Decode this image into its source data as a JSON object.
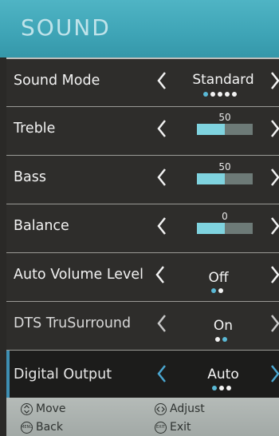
{
  "header": {
    "title": "SOUND"
  },
  "rows": [
    {
      "label": "Sound Mode",
      "value": "Standard",
      "dots": 5,
      "active_dot": 0
    },
    {
      "label": "Treble",
      "value": "50",
      "level": 0.5
    },
    {
      "label": "Bass",
      "value": "50",
      "level": 0.5
    },
    {
      "label": "Balance",
      "value": "0",
      "level": 0.5
    },
    {
      "label": "Auto Volume Level",
      "value": "Off",
      "dots": 2,
      "active_dot": 0
    },
    {
      "label": "DTS TruSurround",
      "value": "On",
      "dots": 2,
      "active_dot": 1
    },
    {
      "label": "Digital Output",
      "value": "Auto",
      "dots": 3,
      "active_dot": 0
    }
  ],
  "footer": {
    "move": "Move",
    "adjust": "Adjust",
    "back": "Back",
    "exit": "Exit",
    "back_key": "MENU",
    "exit_key": "EXIT"
  },
  "colors": {
    "accent": "#4fb4c4",
    "dot_active": "#5ab9d6",
    "slider_fill": "#7fd3df"
  },
  "icons": [
    "chevron-left-icon",
    "chevron-right-icon",
    "dpad-vertical-icon",
    "dpad-horizontal-icon",
    "menu-button-icon",
    "exit-button-icon"
  ]
}
